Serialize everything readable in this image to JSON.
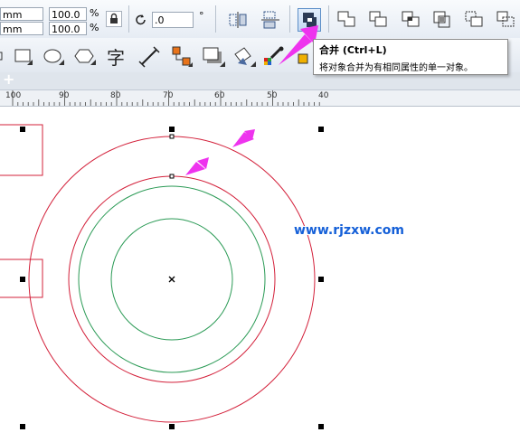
{
  "property_bar": {
    "width_unit": "mm",
    "height_unit": "mm",
    "scale_x": "100.0",
    "scale_y": "100.0",
    "percent": "%",
    "rotation_value": ".0",
    "degree": "°"
  },
  "tooltip": {
    "title": "合并 (Ctrl+L)",
    "description": "将对象合并为有相同属性的单一对象。"
  },
  "toolbar2": {
    "text_tool_glyph": "字"
  },
  "tabstrip": {
    "add_label": "+"
  },
  "ruler": {
    "ticks": [
      "100",
      "90",
      "80",
      "70",
      "60",
      "50",
      "40"
    ]
  },
  "watermark": "www.rjzxw.com",
  "colors": {
    "red_outline": "#d3203a",
    "green_outline": "#2a9a55",
    "arrow": "#ee33ee",
    "selection_handle": "#000000"
  }
}
